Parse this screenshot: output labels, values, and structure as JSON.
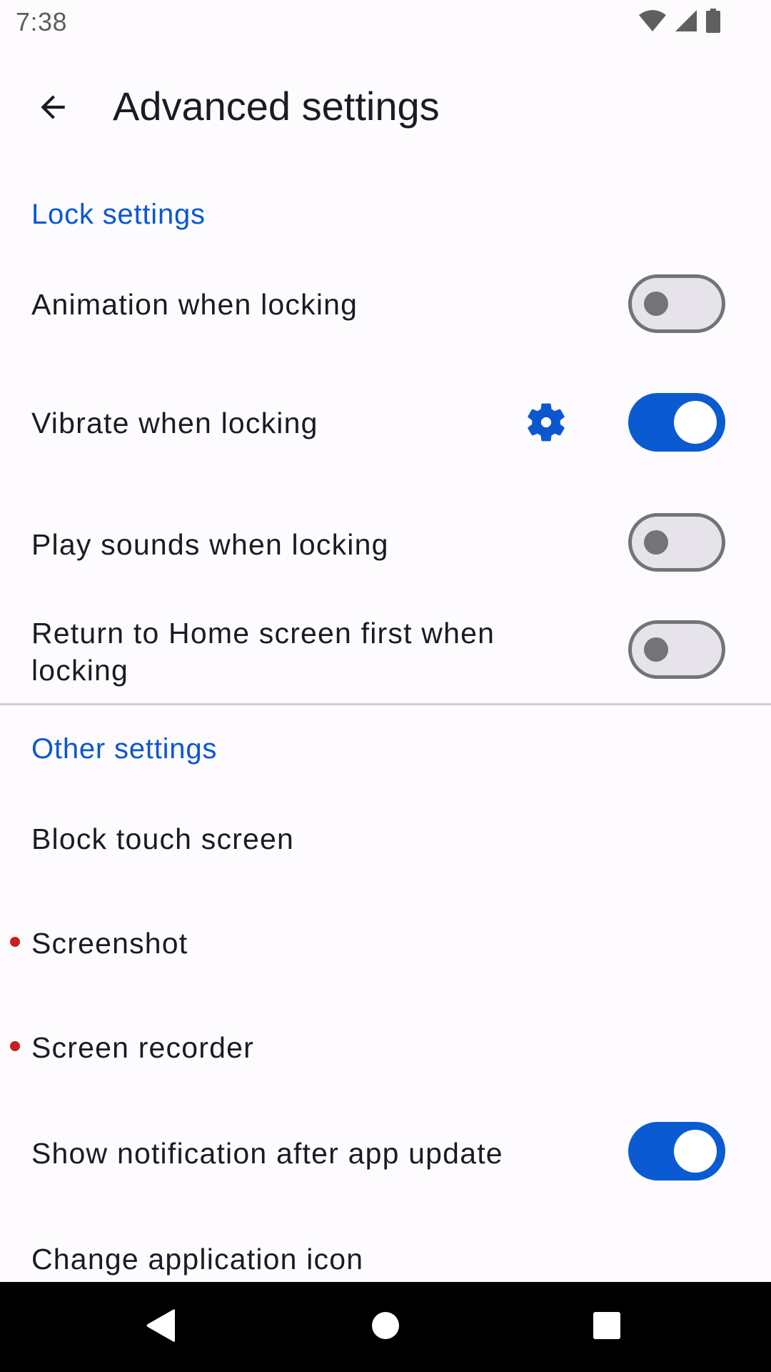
{
  "status_bar": {
    "time": "7:38",
    "icons": [
      "wifi-icon",
      "cellular-signal-icon",
      "battery-icon"
    ]
  },
  "app_bar": {
    "title": "Advanced settings",
    "back_icon": "arrow-back-icon"
  },
  "colors": {
    "accent": "#0b57d0",
    "toggle_on": "#0a5bd1",
    "toggle_off_track": "#e6e3eb",
    "toggle_off_outline": "#747378",
    "new_indicator": "#c8201c",
    "background": "#fdfbfe"
  },
  "lock_settings": {
    "header": "Lock settings",
    "items": [
      {
        "label": "Animation when locking",
        "enabled": false
      },
      {
        "label": "Vibrate when locking",
        "enabled": true,
        "has_settings_icon": true
      },
      {
        "label": "Play sounds when locking",
        "enabled": false
      },
      {
        "label": "Return to Home screen first when locking",
        "enabled": false
      }
    ]
  },
  "other_settings": {
    "header": "Other settings",
    "items": [
      {
        "label": "Block touch screen"
      },
      {
        "label": "Screenshot",
        "new_indicator": true
      },
      {
        "label": "Screen recorder",
        "new_indicator": true
      },
      {
        "label": "Show notification after app update",
        "enabled": true
      },
      {
        "label": "Change application icon"
      }
    ]
  },
  "nav_bar": {
    "buttons": [
      "nav-back-icon",
      "nav-home-icon",
      "nav-recents-icon"
    ]
  }
}
